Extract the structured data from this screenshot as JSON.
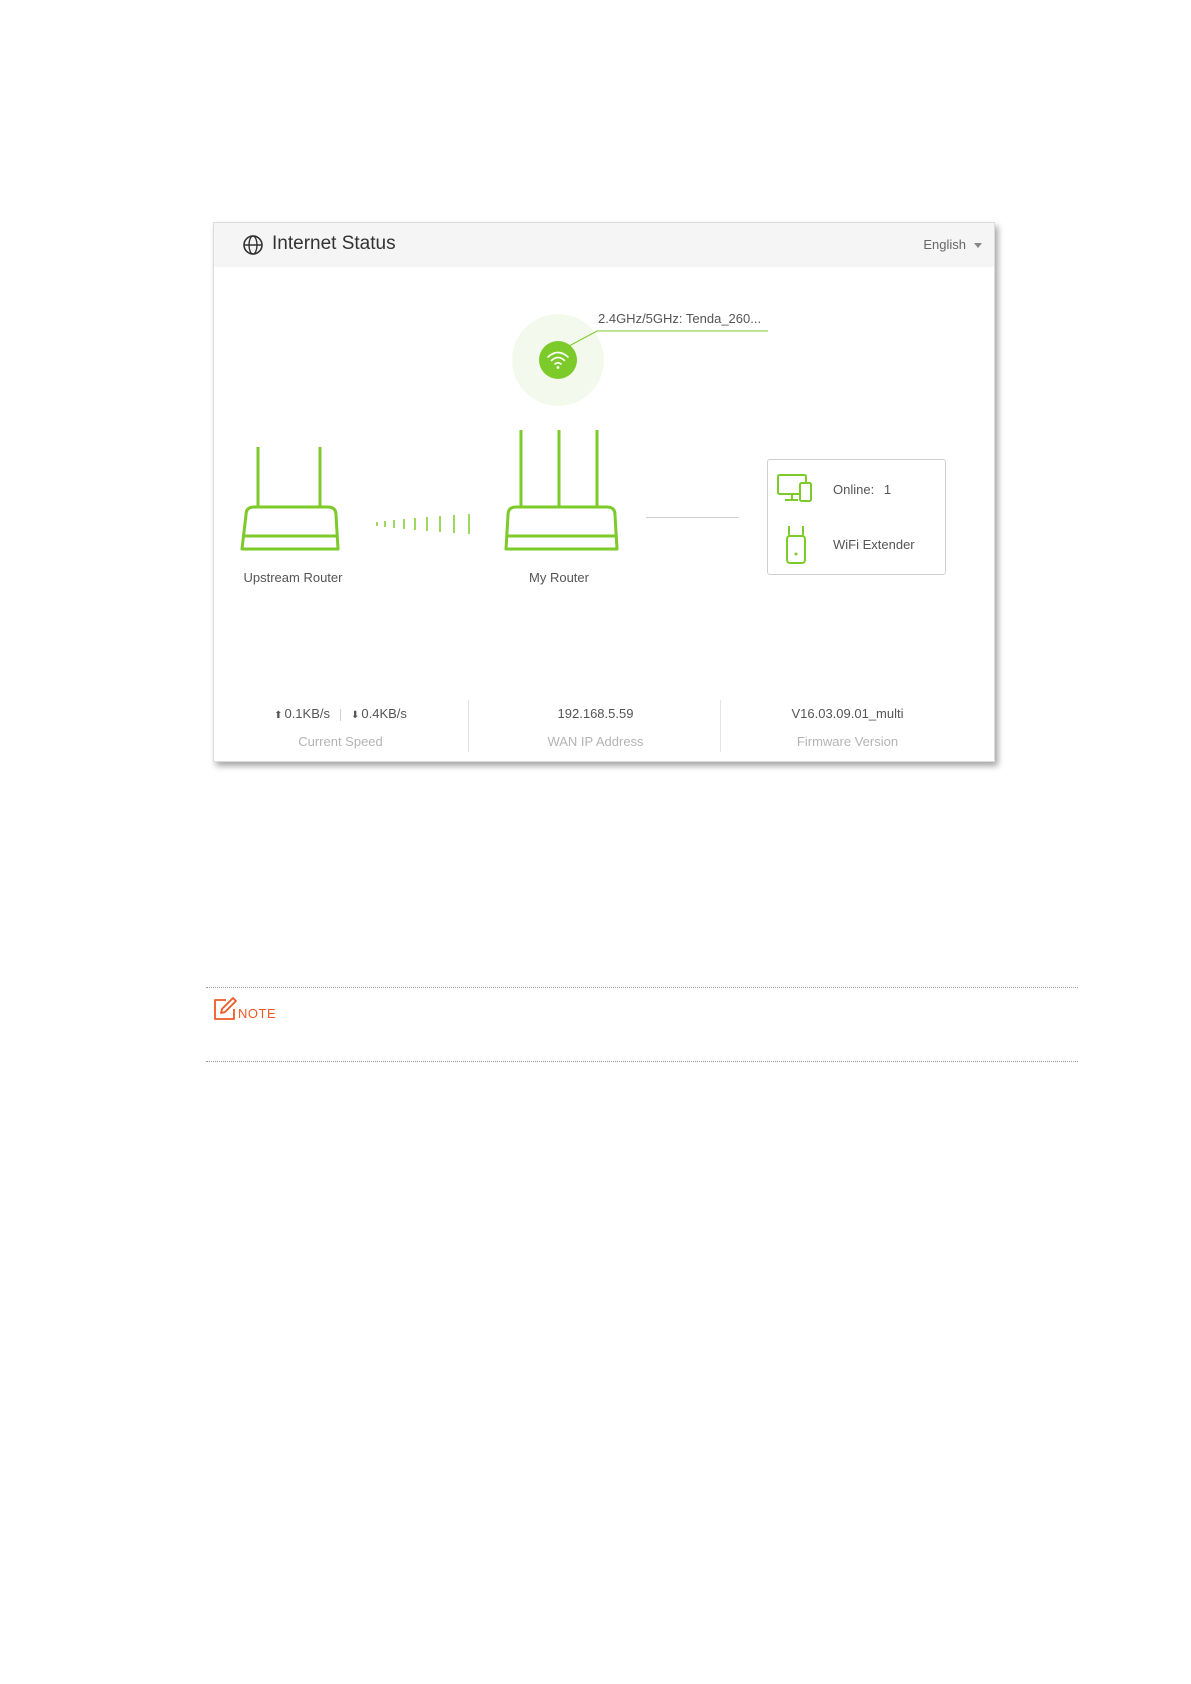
{
  "header": {
    "icon": "globe-icon",
    "title": "Internet Status",
    "language": "English"
  },
  "topology": {
    "wifi": {
      "icon": "wifi-icon",
      "ssid": "2.4GHz/5GHz: Tenda_260..."
    },
    "upstream_router": {
      "icon": "router-icon",
      "label": "Upstream Router"
    },
    "my_router": {
      "icon": "router-icon",
      "label": "My Router"
    },
    "clients": {
      "online_label": "Online:",
      "online_count": "1",
      "online_icon": "devices-icon",
      "extender_label": "WiFi Extender",
      "extender_icon": "wifi-extender-icon"
    }
  },
  "stats": {
    "upload": "0.1KB/s",
    "download": "0.4KB/s",
    "speed_label": "Current Speed",
    "wan_ip": "192.168.5.59",
    "wan_ip_label": "WAN IP Address",
    "firmware": "V16.03.09.01_multi",
    "firmware_label": "Firmware Version"
  },
  "note": {
    "icon": "note-pencil-icon",
    "label": "NOTE"
  },
  "colors": {
    "accent": "#7ccb2a",
    "note": "#ee5a24"
  }
}
